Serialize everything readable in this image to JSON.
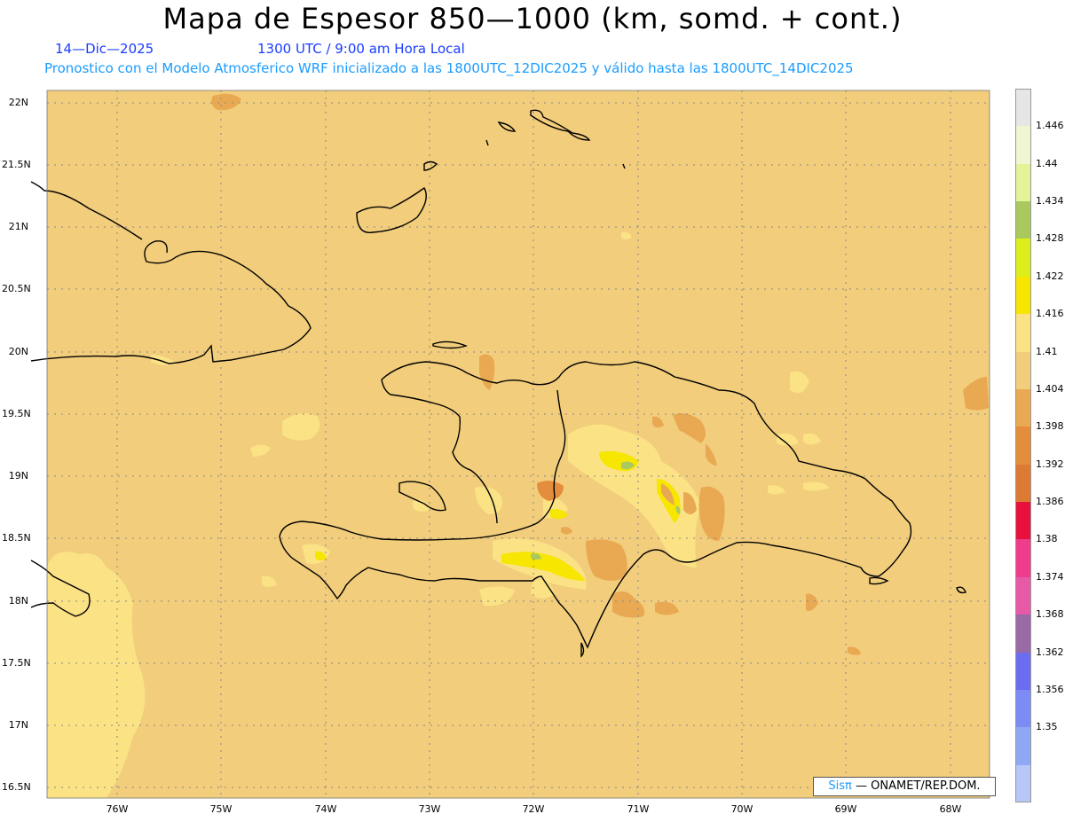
{
  "title": "Mapa de Espesor 850—1000 (km, somd. + cont.)",
  "date": "14—Dic—2025",
  "time": "1300 UTC / 9:00 am Hora Local",
  "description": "Pronostico con el Modelo Atmosferico WRF inicializado a las 1800UTC_12DIC2025 y válido hasta las  1800UTC_14DIC2025",
  "credit": {
    "brand": "Sisπ",
    "rest": "— ONAMET/REP.DOM."
  },
  "lat_labels": [
    "22N",
    "21.5N",
    "21N",
    "20.5N",
    "20N",
    "19.5N",
    "19N",
    "18.5N",
    "18N",
    "17.5N",
    "17N",
    "16.5N"
  ],
  "lon_labels": [
    "76W",
    "75W",
    "74W",
    "73W",
    "72W",
    "71W",
    "70W",
    "69W",
    "68W"
  ],
  "colorbar": {
    "labels": [
      "1.446",
      "1.44",
      "1.434",
      "1.428",
      "1.422",
      "1.416",
      "1.41",
      "1.404",
      "1.398",
      "1.392",
      "1.386",
      "1.38",
      "1.374",
      "1.368",
      "1.362",
      "1.356",
      "1.35"
    ],
    "colors": [
      "#e6e6e6",
      "#f2f5d2",
      "#e2f39a",
      "#a9c95e",
      "#dcee1c",
      "#f7e600",
      "#fae285",
      "#f2cd7b",
      "#e9a852",
      "#e48d3c",
      "#dc7a34",
      "#e8103c",
      "#f03c8c",
      "#e85aa8",
      "#9a6aa6",
      "#6b6cf0",
      "#7c8cf4",
      "#8ea8f6",
      "#b8c6f8"
    ]
  },
  "legend_colors": {
    "ocean_background": "#f2cd7b",
    "coast": "#000000",
    "grid": "#888888"
  }
}
